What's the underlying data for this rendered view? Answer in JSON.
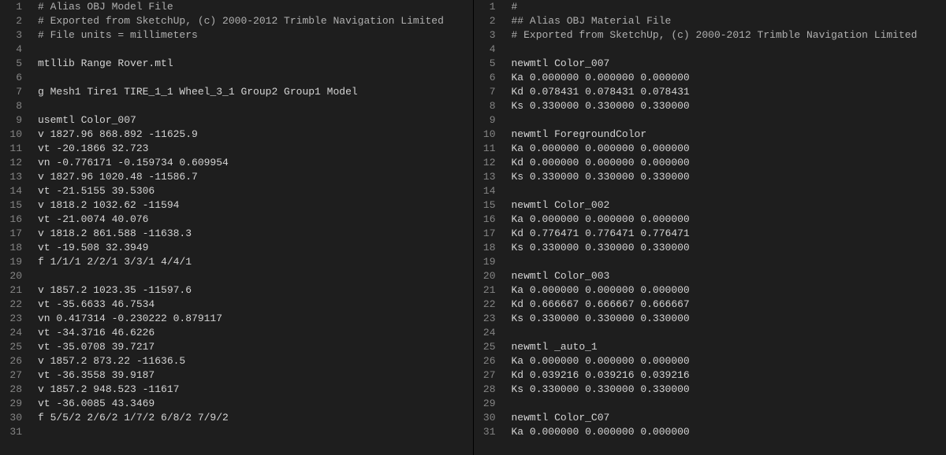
{
  "left": {
    "lines": {
      "1": "# Alias OBJ Model File",
      "2": "# Exported from SketchUp, (c) 2000-2012 Trimble Navigation Limited",
      "3": "# File units = millimeters",
      "4": "",
      "5": "mtllib Range Rover.mtl",
      "6": "",
      "7": "g Mesh1 Tire1 TIRE_1_1 Wheel_3_1 Group2 Group1 Model",
      "8": "",
      "9": "usemtl Color_007",
      "10": "v 1827.96 868.892 -11625.9",
      "11": "vt -20.1866 32.723",
      "12": "vn -0.776171 -0.159734 0.609954",
      "13": "v 1827.96 1020.48 -11586.7",
      "14": "vt -21.5155 39.5306",
      "15": "v 1818.2 1032.62 -11594",
      "16": "vt -21.0074 40.076",
      "17": "v 1818.2 861.588 -11638.3",
      "18": "vt -19.508 32.3949",
      "19": "f 1/1/1 2/2/1 3/3/1 4/4/1",
      "20": "",
      "21": "v 1857.2 1023.35 -11597.6",
      "22": "vt -35.6633 46.7534",
      "23": "vn 0.417314 -0.230222 0.879117",
      "24": "vt -34.3716 46.6226",
      "25": "vt -35.0708 39.7217",
      "26": "v 1857.2 873.22 -11636.5",
      "27": "vt -36.3558 39.9187",
      "28": "v 1857.2 948.523 -11617",
      "29": "vt -36.0085 43.3469",
      "30": "f 5/5/2 2/6/2 1/7/2 6/8/2 7/9/2",
      "31": ""
    }
  },
  "right": {
    "lines": {
      "1": "#",
      "2": "## Alias OBJ Material File",
      "3": "# Exported from SketchUp, (c) 2000-2012 Trimble Navigation Limited",
      "4": "",
      "5": "newmtl Color_007",
      "6": "Ka 0.000000 0.000000 0.000000",
      "7": "Kd 0.078431 0.078431 0.078431",
      "8": "Ks 0.330000 0.330000 0.330000",
      "9": "",
      "10": "newmtl ForegroundColor",
      "11": "Ka 0.000000 0.000000 0.000000",
      "12": "Kd 0.000000 0.000000 0.000000",
      "13": "Ks 0.330000 0.330000 0.330000",
      "14": "",
      "15": "newmtl Color_002",
      "16": "Ka 0.000000 0.000000 0.000000",
      "17": "Kd 0.776471 0.776471 0.776471",
      "18": "Ks 0.330000 0.330000 0.330000",
      "19": "",
      "20": "newmtl Color_003",
      "21": "Ka 0.000000 0.000000 0.000000",
      "22": "Kd 0.666667 0.666667 0.666667",
      "23": "Ks 0.330000 0.330000 0.330000",
      "24": "",
      "25": "newmtl _auto_1",
      "26": "Ka 0.000000 0.000000 0.000000",
      "27": "Kd 0.039216 0.039216 0.039216",
      "28": "Ks 0.330000 0.330000 0.330000",
      "29": "",
      "30": "newmtl Color_C07",
      "31": "Ka 0.000000 0.000000 0.000000"
    }
  }
}
